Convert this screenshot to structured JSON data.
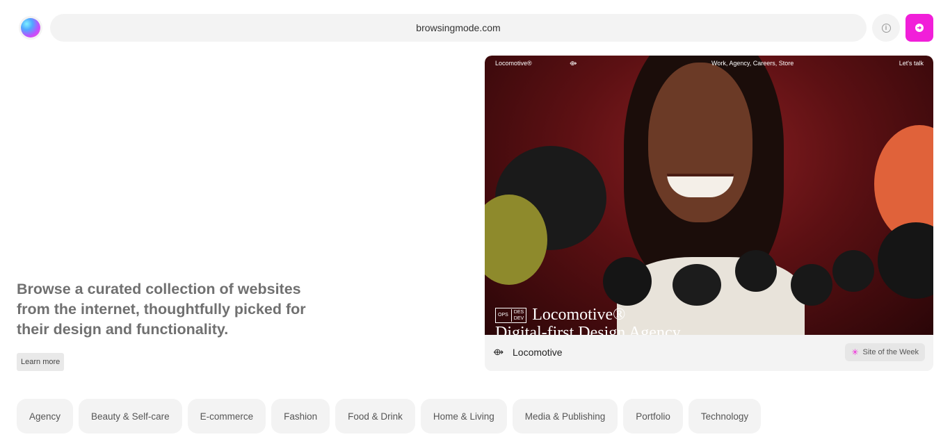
{
  "header": {
    "url": "browsingmode.com"
  },
  "intro": {
    "headline": "Browse a curated collection of websites from the internet, thoughtfully picked for their design and functionality.",
    "learn_more": "Learn more"
  },
  "featured": {
    "preview": {
      "brand": "Locomotive®",
      "nav_links": "Work, Agency, Careers, Store",
      "cta": "Let's talk",
      "badge_left": "OPS",
      "badge_top": "DES",
      "badge_bottom": "DEV",
      "wordmark": "Locomotive®",
      "tagline": "Digital-first Design Agency"
    },
    "site_name": "Locomotive",
    "badge": "Site of the Week",
    "colors": {
      "accent": "#f11fd9"
    }
  },
  "categories": [
    "Agency",
    "Beauty & Self-care",
    "E-commerce",
    "Fashion",
    "Food & Drink",
    "Home & Living",
    "Media & Publishing",
    "Portfolio",
    "Technology"
  ]
}
